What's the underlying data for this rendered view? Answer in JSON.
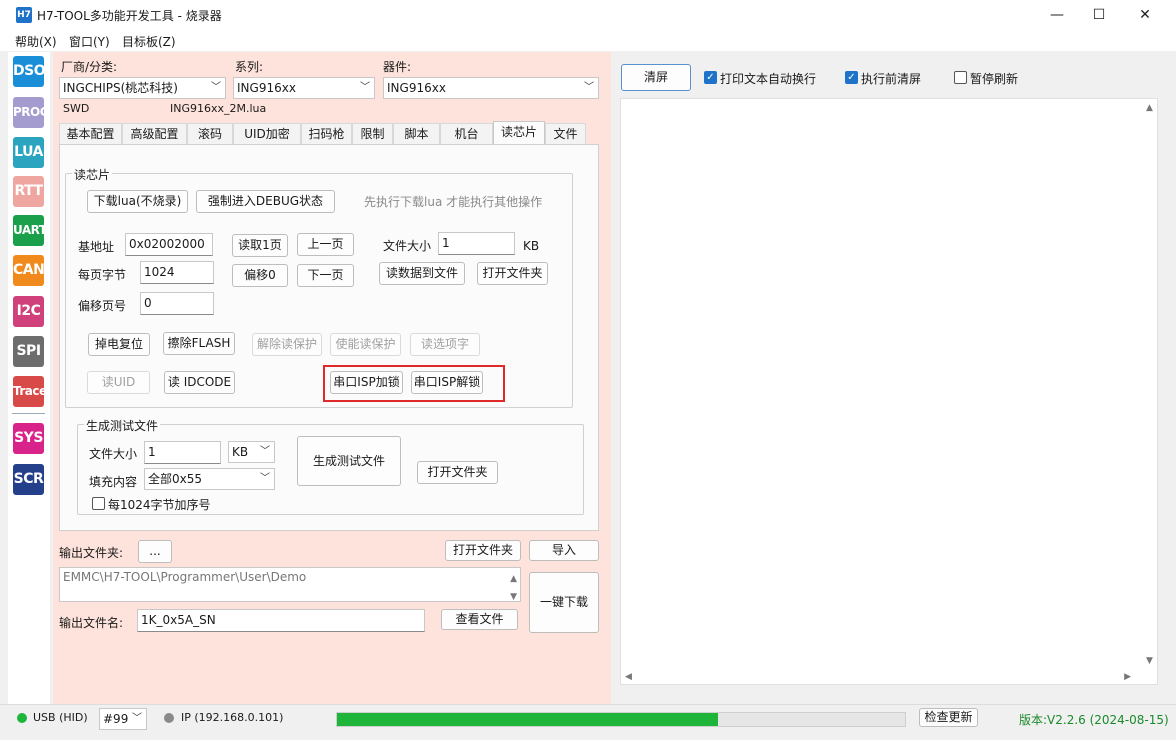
{
  "window": {
    "icon_text": "H7",
    "title": "H7-TOOL多功能开发工具 - 烧录器",
    "minimize": "—",
    "maximize": "☐",
    "close": "✕"
  },
  "menu": [
    "帮助(X)",
    "窗口(Y)",
    "目标板(Z)"
  ],
  "tools": [
    {
      "label": "DSO",
      "color": "#1a8fd8"
    },
    {
      "label": "PROG",
      "color": "#a49ccf"
    },
    {
      "label": "LUA",
      "color": "#2aa4bf"
    },
    {
      "label": "RTT",
      "color": "#f0a6a0"
    },
    {
      "label": "UART",
      "color": "#1aa04a"
    },
    {
      "label": "CAN",
      "color": "#f08a1c"
    },
    {
      "label": "I2C",
      "color": "#d0407a"
    },
    {
      "label": "SPI",
      "color": "#6d6d6d"
    },
    {
      "label": "Trace",
      "color": "#d84a48"
    },
    {
      "label": "SYS",
      "color": "#d8248a"
    },
    {
      "label": "SCR",
      "color": "#25408a"
    }
  ],
  "config": {
    "vendor_label": "厂商/分类:",
    "vendor_value": "INGCHIPS(桃芯科技)",
    "series_label": "系列:",
    "series_value": "ING916xx",
    "device_label": "器件:",
    "device_value": "ING916xx",
    "interface": "SWD",
    "lua_file": "ING916xx_2M.lua"
  },
  "tabs": [
    "基本配置",
    "高级配置",
    "滚码",
    "UID加密",
    "扫码枪",
    "限制",
    "脚本",
    "机台",
    "读芯片",
    "文件"
  ],
  "read_chip": {
    "group_title": "读芯片",
    "download_lua": "下载lua(不烧录)",
    "force_debug": "强制进入DEBUG状态",
    "hint": "先执行下载lua 才能执行其他操作",
    "base_addr_label": "基地址",
    "base_addr_value": "0x02002000",
    "read_page": "读取1页",
    "prev_page": "上一页",
    "file_size_label": "文件大小",
    "file_size_value": "1",
    "file_size_unit": "KB",
    "page_bytes_label": "每页字节",
    "page_bytes_value": "1024",
    "offset0": "偏移0",
    "next_page": "下一页",
    "read_to_file": "读数据到文件",
    "open_folder": "打开文件夹",
    "offset_page_label": "偏移页号",
    "offset_page_value": "0",
    "power_reset": "掉电复位",
    "erase_flash": "擦除FLASH",
    "remove_protect": "解除读保护",
    "enable_protect": "使能读保护",
    "read_option": "读选项字",
    "read_uid": "读UID",
    "read_idcode": "读 IDCODE",
    "isp_lock": "串口ISP加锁",
    "isp_unlock": "串口ISP解锁"
  },
  "gen_test": {
    "group_title": "生成测试文件",
    "file_size_label": "文件大小",
    "file_size_value": "1",
    "unit_value": "KB",
    "fill_label": "填充内容",
    "fill_value": "全部0x55",
    "generate_button": "生成测试文件",
    "open_folder": "打开文件夹",
    "seq_checkbox": "每1024字节加序号"
  },
  "output_area": {
    "out_folder_label": "输出文件夹:",
    "browse_button": "...",
    "open_folder": "打开文件夹",
    "import_button": "导入",
    "path_value": "EMMC\\H7-TOOL\\Programmer\\User\\Demo",
    "one_key_download": "一键下载",
    "out_name_label": "输出文件名:",
    "out_name_value": "1K_0x5A_SN",
    "view_file": "查看文件"
  },
  "right": {
    "clear_button": "清屏",
    "auto_wrap": "打印文本自动换行",
    "clear_before_exec": "执行前清屏",
    "pause_refresh": "暂停刷新"
  },
  "status": {
    "usb_label": "USB (HID)",
    "usb_color": "#1fb53a",
    "device_id": "#99",
    "ip_label": "IP (192.168.0.101)",
    "ip_color": "#8a8a8a",
    "progress_percent": 67,
    "check_update": "检查更新",
    "version": "版本:V2.2.6 (2024-08-15)",
    "version_color": "#1a8a2a"
  }
}
